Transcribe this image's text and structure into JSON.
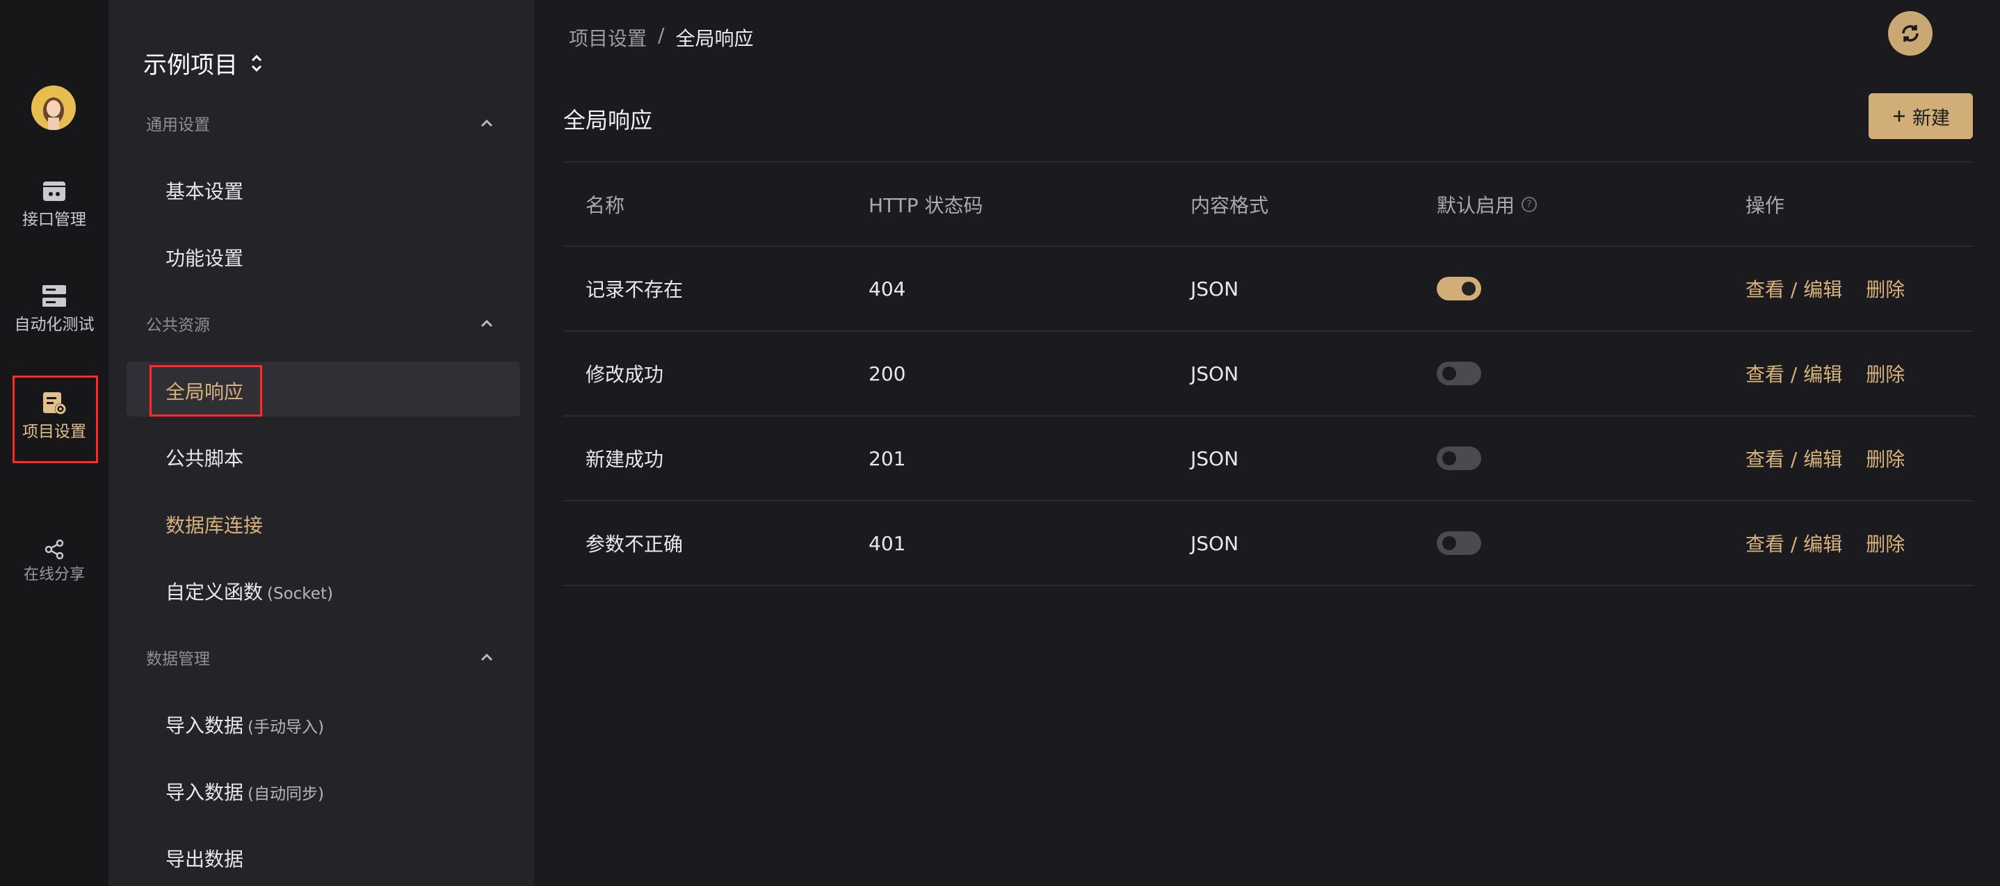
{
  "colors": {
    "accent": "#d1ae78",
    "highlight_box": "#ff2a2a",
    "rail_bg": "#17171a",
    "sidebar_bg": "#232328",
    "main_bg": "#1b1b1f"
  },
  "rail": {
    "items": [
      {
        "label": "接口管理",
        "icon": "api-management-icon"
      },
      {
        "label": "自动化测试",
        "icon": "automation-test-icon"
      },
      {
        "label": "项目设置",
        "icon": "project-settings-icon"
      },
      {
        "label": "在线分享",
        "icon": "share-icon"
      }
    ]
  },
  "sidebar": {
    "project_name": "示例项目",
    "groups": [
      {
        "title": "通用设置",
        "items": [
          {
            "label": "基本设置",
            "suffix": ""
          },
          {
            "label": "功能设置",
            "suffix": ""
          }
        ]
      },
      {
        "title": "公共资源",
        "items": [
          {
            "label": "全局响应",
            "suffix": ""
          },
          {
            "label": "公共脚本",
            "suffix": ""
          },
          {
            "label": "数据库连接",
            "suffix": ""
          },
          {
            "label": "自定义函数",
            "suffix": "(Socket)"
          }
        ]
      },
      {
        "title": "数据管理",
        "items": [
          {
            "label": "导入数据",
            "suffix": "(手动导入)"
          },
          {
            "label": "导入数据",
            "suffix": "(自动同步)"
          },
          {
            "label": "导出数据",
            "suffix": ""
          }
        ]
      }
    ]
  },
  "main": {
    "breadcrumb": [
      "项目设置",
      "全局响应"
    ],
    "breadcrumb_sep": "/",
    "title": "全局响应",
    "new_button": "新建",
    "columns": [
      "名称",
      "HTTP 状态码",
      "内容格式",
      "默认启用",
      "操作"
    ],
    "rows": [
      {
        "name": "记录不存在",
        "code": "404",
        "format": "JSON",
        "default_enabled": true
      },
      {
        "name": "修改成功",
        "code": "200",
        "format": "JSON",
        "default_enabled": false
      },
      {
        "name": "新建成功",
        "code": "201",
        "format": "JSON",
        "default_enabled": false
      },
      {
        "name": "参数不正确",
        "code": "401",
        "format": "JSON",
        "default_enabled": false
      }
    ],
    "ops": {
      "view_edit": "查看 / 编辑",
      "delete": "删除"
    }
  }
}
